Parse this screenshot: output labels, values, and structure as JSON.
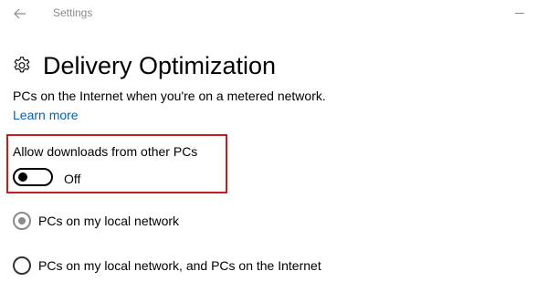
{
  "window": {
    "app_title": "Settings",
    "back_icon": "back-arrow-icon",
    "minimize_icon": "minimize-icon"
  },
  "header": {
    "icon": "gear-icon",
    "title": "Delivery Optimization"
  },
  "description": "PCs on the Internet when you're on a metered network.",
  "learn_more": "Learn more",
  "setting": {
    "label": "Allow downloads from other PCs",
    "toggle_state": "Off",
    "toggle_on": false,
    "highlight_color": "#c0201f"
  },
  "options": [
    {
      "label": "PCs on my local network",
      "selected": true
    },
    {
      "label": "PCs on my local network, and PCs on the Internet",
      "selected": false
    }
  ],
  "colors": {
    "link": "#0063b1",
    "muted": "#8a8a8a"
  }
}
